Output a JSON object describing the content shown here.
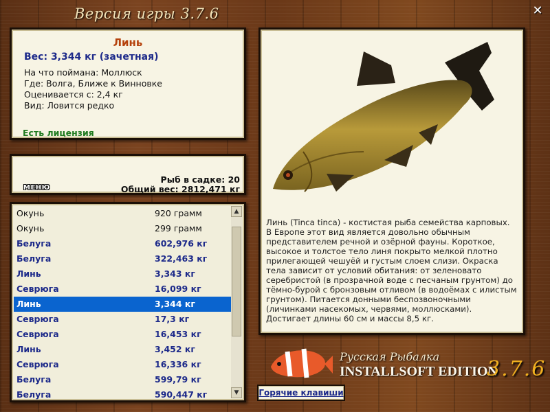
{
  "window": {
    "title": "Версия игры 3.7.6",
    "close_icon": "close-icon"
  },
  "fish_info": {
    "name": "Линь",
    "weight": "Вес: 3,344 кг (зачетная)",
    "lines": [
      "На что поймана: Моллюск",
      "Где: Волга, Ближе к Винновке",
      "Оценивается с: 2,4 кг",
      "Вид: Ловится редко"
    ],
    "license": "Есть лицензия"
  },
  "cage": {
    "menu_label": "МЕНЮ",
    "count": "Рыб в садке: 20",
    "total_weight": "Общий вес: 2812,471 кг"
  },
  "catch_list": {
    "rows": [
      {
        "name": "Окунь",
        "weight": "920 грамм",
        "style": "plain"
      },
      {
        "name": "Окунь",
        "weight": "299 грамм",
        "style": "plain"
      },
      {
        "name": "Белуга",
        "weight": "602,976 кг",
        "style": "bold"
      },
      {
        "name": "Белуга",
        "weight": "322,463 кг",
        "style": "bold"
      },
      {
        "name": "Линь",
        "weight": "3,343 кг",
        "style": "bold"
      },
      {
        "name": "Севрюга",
        "weight": "16,099 кг",
        "style": "bold"
      },
      {
        "name": "Линь",
        "weight": "3,344 кг",
        "style": "selected"
      },
      {
        "name": "Севрюга",
        "weight": "17,3 кг",
        "style": "bold"
      },
      {
        "name": "Севрюга",
        "weight": "16,453 кг",
        "style": "bold"
      },
      {
        "name": "Линь",
        "weight": "3,452 кг",
        "style": "bold"
      },
      {
        "name": "Севрюга",
        "weight": "16,336 кг",
        "style": "bold"
      },
      {
        "name": "Белуга",
        "weight": "599,79 кг",
        "style": "bold"
      },
      {
        "name": "Белуга",
        "weight": "590,447 кг",
        "style": "bold"
      }
    ],
    "scroll_up_icon": "chevron-up-icon",
    "scroll_down_icon": "chevron-down-icon"
  },
  "description": "Линь (Tinca tinca) - костистая рыба семейства карповых. В Европе этот вид является довольно обычным представителем речной и озёрной фауны. Короткое, высокое и толстое тело линя покрыто мелкой плотно прилегающей чешуёй и густым слоем слизи. Окраска тела зависит от условий обитания: от зеленовато серебристой (в прозрачной воде с песчаным грунтом) до тёмно-бурой с бронзовым отливом (в водоёмах с илистым грунтом). Питается донными беспозвоночными (личинками насекомых, червями, моллюсками). Достигает длины 60 см и массы 8,5 кг.",
  "brand": {
    "line1": "Русская Рыбалка",
    "line2": "INSTALLSOFT EDITION",
    "version": "3.7.6"
  },
  "hotkeys_label": "Горячие клавиши",
  "colors": {
    "accent_name": "#b5420d",
    "value_blue": "#1d2a8a",
    "license_green": "#1f7a1f",
    "selection": "#0a64cf"
  }
}
